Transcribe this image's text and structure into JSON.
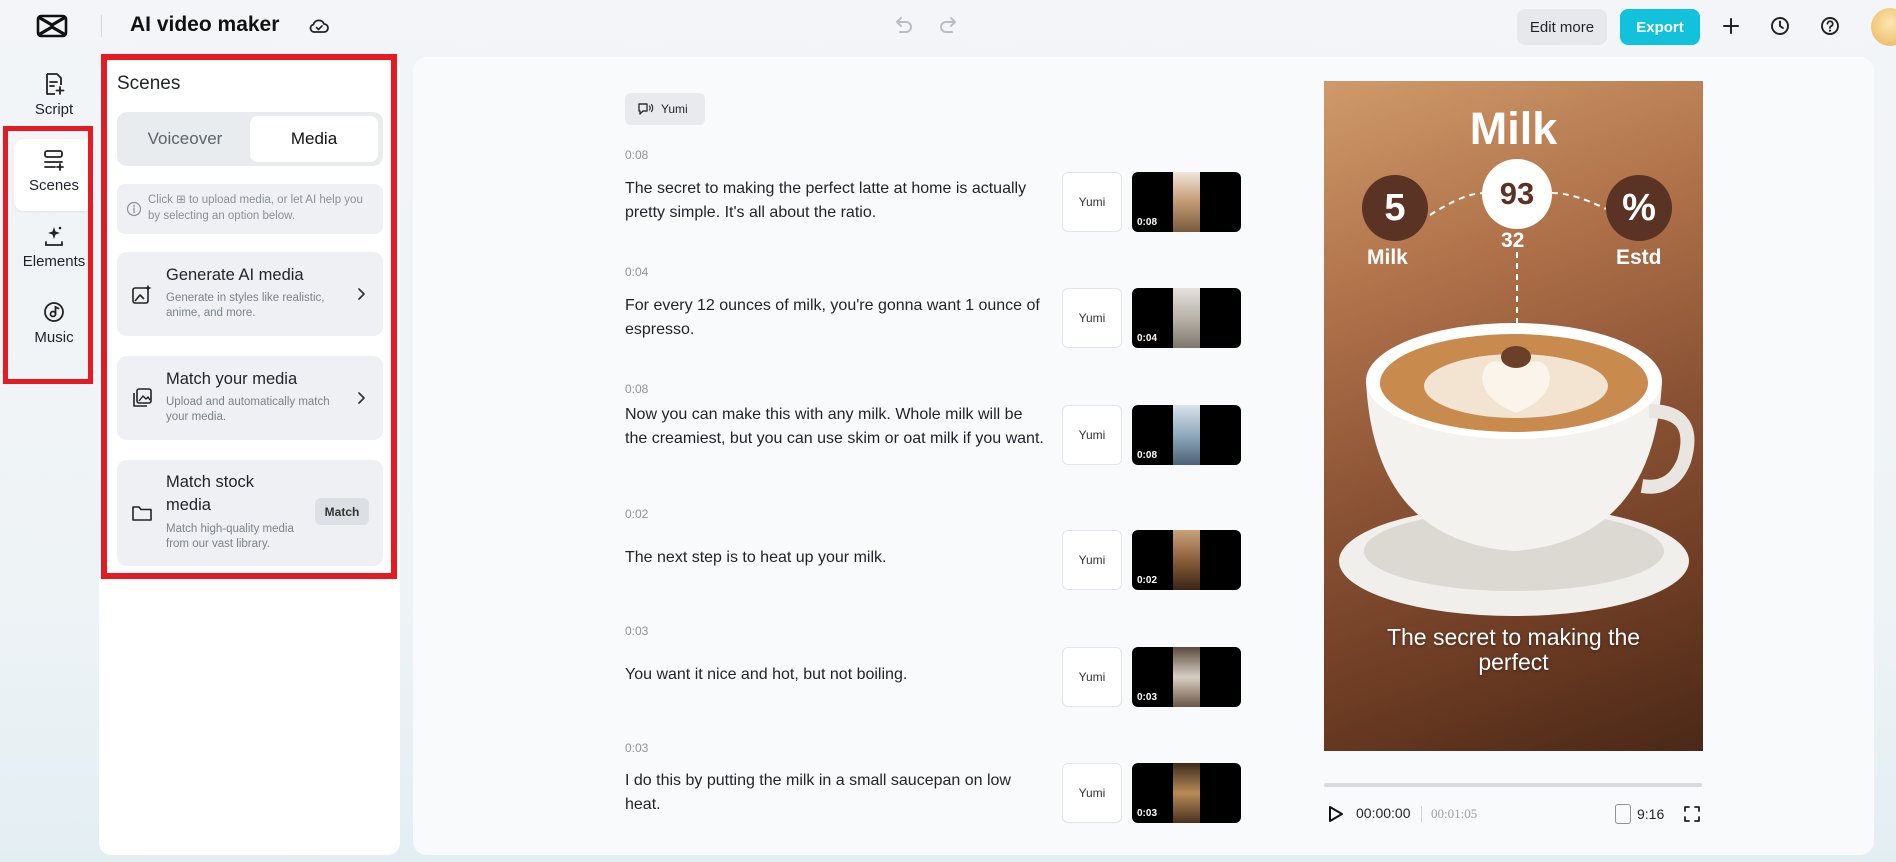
{
  "app": {
    "title": "AI video maker"
  },
  "toolbar": {
    "edit_more_label": "Edit more",
    "export_label": "Export",
    "accent": "#12c2dd"
  },
  "rail": {
    "items": [
      {
        "label": "Script",
        "icon": "script-icon"
      },
      {
        "label": "Scenes",
        "icon": "scenes-icon",
        "active": true
      },
      {
        "label": "Elements",
        "icon": "elements-icon"
      },
      {
        "label": "Music",
        "icon": "music-icon"
      }
    ]
  },
  "scenes_panel": {
    "title": "Scenes",
    "tabs": [
      {
        "label": "Voiceover"
      },
      {
        "label": "Media",
        "active": true
      }
    ],
    "hint": "Click ⊞ to upload media, or let AI help you by selecting an option below.",
    "options": [
      {
        "title": "Generate AI media",
        "description": "Generate in styles like realistic, anime, and more.",
        "icon": "ai-image-icon"
      },
      {
        "title": "Match your media",
        "description": "Upload and automatically match your media.",
        "icon": "media-stack-icon"
      },
      {
        "title": "Match stock media",
        "description": "Match high-quality media from our vast library.",
        "icon": "folder-icon",
        "action_label": "Match"
      }
    ]
  },
  "script": {
    "voice_chip": "Yumi",
    "scenes": [
      {
        "time": "0:08",
        "text": "The secret to making the perfect latte at home is actually pretty simple. It's all about the ratio.",
        "voice": "Yumi",
        "clip_duration": "0:08"
      },
      {
        "time": "0:04",
        "text": "For every 12 ounces of milk, you're gonna want 1 ounce of espresso.",
        "voice": "Yumi",
        "clip_duration": "0:04"
      },
      {
        "time": "0:08",
        "text": "Now you can make this with any milk. Whole milk will be the creamiest, but you can use skim or oat milk if you want.",
        "voice": "Yumi",
        "clip_duration": "0:08"
      },
      {
        "time": "0:02",
        "text": "The next step is to heat up your milk.",
        "voice": "Yumi",
        "clip_duration": "0:02"
      },
      {
        "time": "0:03",
        "text": "You want it nice and hot, but not boiling.",
        "voice": "Yumi",
        "clip_duration": "0:03"
      },
      {
        "time": "0:03",
        "text": "I do this by putting the milk in a small saucepan on low heat.",
        "voice": "Yumi",
        "clip_duration": "0:03"
      }
    ]
  },
  "preview": {
    "title": "Milk",
    "left_value": "5",
    "left_label": "Milk",
    "mid_value": "93",
    "mid_number": "32",
    "right_value": "%",
    "right_label": "Estd",
    "caption_line1": "The secret to making the",
    "caption_line2": "perfect"
  },
  "player": {
    "current_time": "00:00:00",
    "total_time": "00:01:05",
    "aspect_ratio": "9:16",
    "progress": 0
  }
}
